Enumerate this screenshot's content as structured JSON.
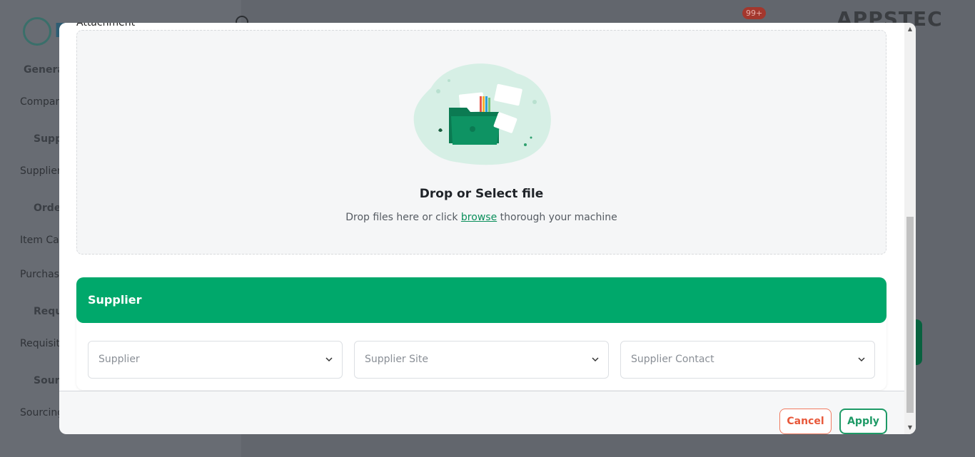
{
  "background": {
    "nav_items": [
      {
        "label": "Genera",
        "section": true
      },
      {
        "label": "Compan",
        "section": false
      },
      {
        "label": "Supp",
        "section": true
      },
      {
        "label": "Supplier",
        "section": false
      },
      {
        "label": "Order",
        "section": true
      },
      {
        "label": "Item Cat",
        "section": false
      },
      {
        "label": "Purchas",
        "section": false
      },
      {
        "label": "Requi",
        "section": true
      },
      {
        "label": "Requisit",
        "section": false
      },
      {
        "label": "Sourc",
        "section": true
      },
      {
        "label": "Sourcing",
        "section": false
      }
    ],
    "notification_count": "99+",
    "brand": "APPSTEC"
  },
  "modal": {
    "attachment_label": "Attachment",
    "dropzone": {
      "title": "Drop or Select file",
      "sub_before": "Drop files here or click ",
      "browse_link": "browse",
      "sub_after": " thorough your machine"
    },
    "supplier": {
      "header": "Supplier",
      "fields": [
        {
          "placeholder": "Supplier"
        },
        {
          "placeholder": "Supplier Site"
        },
        {
          "placeholder": "Supplier Contact"
        }
      ]
    },
    "buttons": {
      "cancel": "Cancel",
      "apply": "Apply"
    }
  },
  "colors": {
    "accent": "#00a86b",
    "cancel": "#e8583a",
    "apply": "#1e9a66"
  }
}
